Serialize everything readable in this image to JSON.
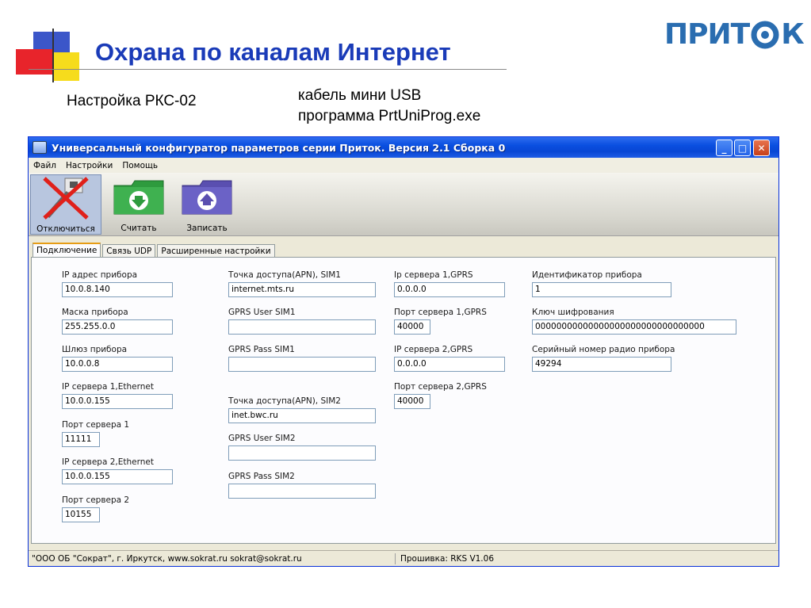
{
  "slide": {
    "title": "Охрана по каналам Интернет",
    "logo_text_left": "ПРИТ",
    "logo_text_right": "К",
    "note_left": "Настройка РКС-02",
    "note_right_line1": "кабель мини USB",
    "note_right_line2": "программа  PrtUniProg.exe"
  },
  "window": {
    "title": "Универсальный конфигуратор параметров серии Приток. Версия 2.1 Сборка 0",
    "buttons": {
      "minimize": "_",
      "maximize": "□",
      "close": "✕"
    }
  },
  "menu": [
    "Файл",
    "Настройки",
    "Помощь"
  ],
  "toolbar": {
    "disconnect": "Отключиться",
    "read": "Считать",
    "write": "Записать"
  },
  "tabs": [
    "Подключение",
    "Связь UDP",
    "Расширенные настройки"
  ],
  "fields": {
    "ip_device": {
      "label": "IP адрес прибора",
      "value": "10.0.8.140"
    },
    "mask": {
      "label": "Маска прибора",
      "value": "255.255.0.0"
    },
    "gateway": {
      "label": "Шлюз прибора",
      "value": "10.0.0.8"
    },
    "eth_server1": {
      "label": "IP сервера 1,Ethernet",
      "value": "10.0.0.155"
    },
    "port_server1": {
      "label": "Порт сервера 1",
      "value": "11111"
    },
    "eth_server2": {
      "label": "IP сервера 2,Ethernet",
      "value": "10.0.0.155"
    },
    "port_server2": {
      "label": "Порт сервера 2",
      "value": "10155"
    },
    "apn_sim1": {
      "label": "Точка доступа(APN), SIM1",
      "value": "internet.mts.ru"
    },
    "gprs_user_sim1": {
      "label": "GPRS User SIM1",
      "value": ""
    },
    "gprs_pass_sim1": {
      "label": "GPRS Pass SIM1",
      "value": ""
    },
    "apn_sim2": {
      "label": "Точка доступа(APN), SIM2",
      "value": "inet.bwc.ru"
    },
    "gprs_user_sim2": {
      "label": "GPRS User SIM2",
      "value": ""
    },
    "gprs_pass_sim2": {
      "label": "GPRS Pass SIM2",
      "value": ""
    },
    "gprs_server1_ip": {
      "label": "Ip сервера 1,GPRS",
      "value": "0.0.0.0"
    },
    "gprs_server1_port": {
      "label": "Порт сервера 1,GPRS",
      "value": "40000"
    },
    "gprs_server2_ip": {
      "label": "IP сервера 2,GPRS",
      "value": "0.0.0.0"
    },
    "gprs_server2_port": {
      "label": "Порт сервера 2,GPRS",
      "value": "40000"
    },
    "device_id": {
      "label": "Идентификатор прибора",
      "value": "1"
    },
    "encryption_key": {
      "label": "Ключ шифрования",
      "value": "00000000000000000000000000000000"
    },
    "radio_serial": {
      "label": "Серийный номер радио прибора",
      "value": "49294"
    }
  },
  "status": {
    "left": "\"ООО ОБ \"Сократ\", г. Иркутск,     www.sokrat.ru   sokrat@sokrat.ru",
    "right": "Прошивка: RKS V1.06"
  },
  "colors": {
    "slide_title": "#1a3bb8",
    "logo": "#2a6db0",
    "titlebar": "#0846d4",
    "folder_green": "#2e9b3e",
    "folder_purple": "#5a4fb0",
    "disconnect_cross": "#e0201a"
  },
  "icons": {
    "disconnect": "network-cable-crossed-icon",
    "read": "green-folder-download-icon",
    "write": "purple-folder-upload-icon"
  }
}
